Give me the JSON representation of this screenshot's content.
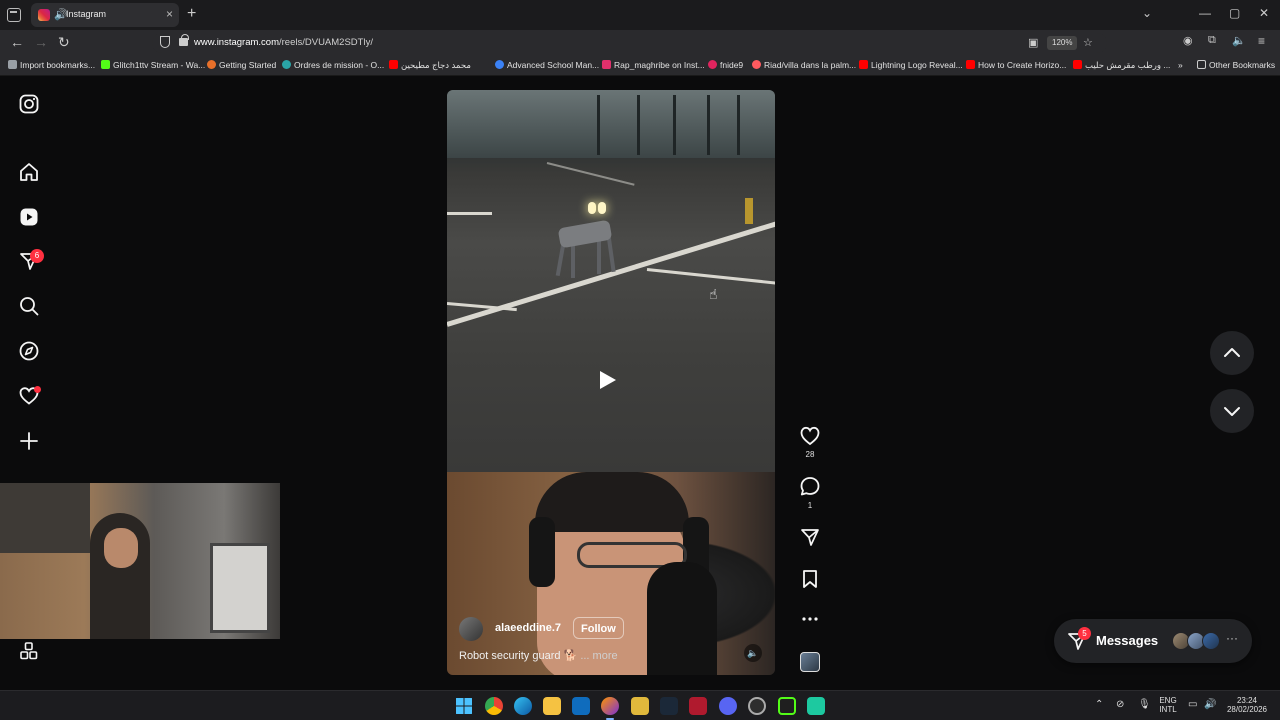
{
  "browser": {
    "tab_title": "Instagram",
    "url_host": "www.instagram.com",
    "url_path": "/reels/DVUAM2SDTly/",
    "zoom": "120%",
    "bookmarks": [
      {
        "label": "Import bookmarks...",
        "color": "#9aa0a6"
      },
      {
        "label": "Glitch1ttv Stream - Wa...",
        "color": "#53fc18"
      },
      {
        "label": "Getting Started",
        "color": "#e8702a"
      },
      {
        "label": "Ordres de mission - O...",
        "color": "#2aa4a6"
      },
      {
        "label": "محمد دجاج مطيحين",
        "color": "#ff0000"
      },
      {
        "label": "Advanced School Man...",
        "color": "#3b82f6"
      },
      {
        "label": "Rap_maghribe on Inst...",
        "color": "#e1306c"
      },
      {
        "label": "fnide9",
        "color": "#e0245e"
      },
      {
        "label": "Riad/villa dans la palm...",
        "color": "#ff5a5f"
      },
      {
        "label": "Lightning Logo Reveal...",
        "color": "#ff0000"
      },
      {
        "label": "How to Create Horizo...",
        "color": "#ff0000"
      },
      {
        "label": "ورطب مقرمش حليب ...",
        "color": "#ff0000"
      }
    ],
    "other_bookmarks": "Other Bookmarks"
  },
  "sidebar": {
    "notifications_badge": "6"
  },
  "reel": {
    "author": "alaeeddine.7",
    "follow_label": "Follow",
    "caption": "Robot security guard 🐕",
    "more_label": "... more",
    "likes": "28",
    "comments": "1"
  },
  "messages": {
    "label": "Messages",
    "badge": "5"
  },
  "taskbar": {
    "lang_top": "ENG",
    "lang_bottom": "INTL",
    "time": "23:24",
    "date": "28/02/2026"
  },
  "colors": {
    "accent_red": "#ff3040",
    "panel_bg": "#222326"
  }
}
